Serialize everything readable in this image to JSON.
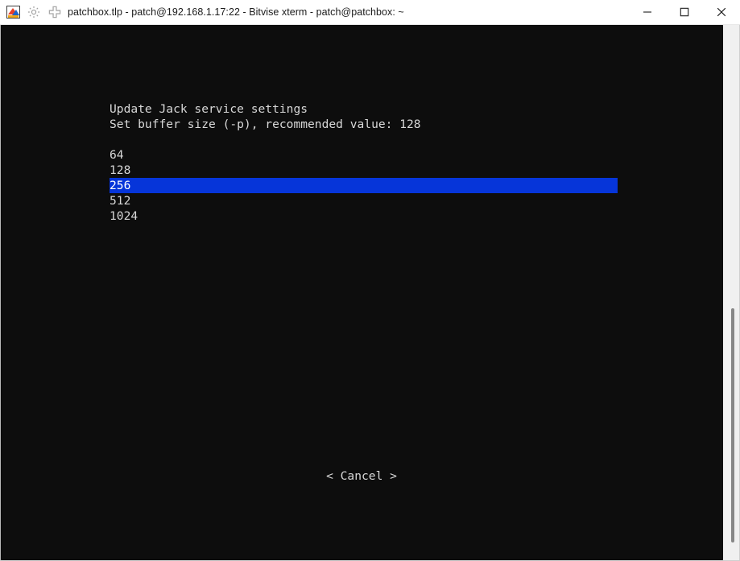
{
  "window": {
    "title": "patchbox.tlp - patch@192.168.1.17:22 - Bitvise xterm - patch@patchbox: ~",
    "icons": {
      "app": "bitvise-app-icon",
      "gear": "gear-icon",
      "plus": "plus-icon"
    },
    "controls": {
      "minimize": "minimize-icon",
      "maximize": "maximize-icon",
      "close": "close-icon"
    },
    "colors": {
      "titlebar_bg": "#ffffff",
      "titlebar_text": "#1b1b1b",
      "terminal_bg": "#0d0d0d",
      "terminal_text": "#d8d8d8",
      "selection_bg": "#0635d9",
      "selection_text": "#ffffff",
      "scrollbar_track": "#f0f0f0",
      "scrollbar_thumb": "#878787"
    }
  },
  "dialog": {
    "title": "Update Jack service settings",
    "subtitle": "Set buffer size (-p), recommended value: 128",
    "options": [
      {
        "label": "64",
        "selected": false
      },
      {
        "label": "128",
        "selected": false
      },
      {
        "label": "256",
        "selected": true
      },
      {
        "label": "512",
        "selected": false
      },
      {
        "label": "1024",
        "selected": false
      }
    ],
    "buttons": {
      "cancel": "< Cancel >"
    }
  }
}
